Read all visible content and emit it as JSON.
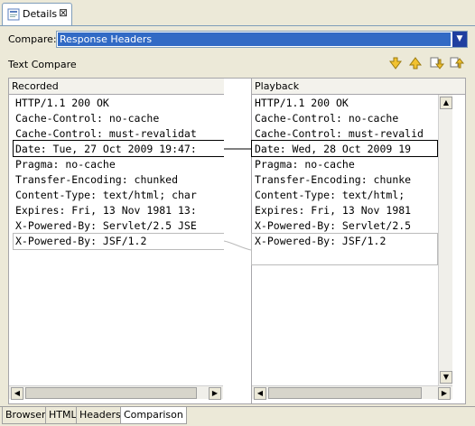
{
  "view_tab": {
    "label": "Details",
    "close": "⊠"
  },
  "compare": {
    "label": "Compare:",
    "value": "Response Headers"
  },
  "text_compare_label": "Text Compare",
  "left": {
    "title": "Recorded",
    "lines": [
      "HTTP/1.1 200 OK",
      "Cache-Control: no-cache",
      "Cache-Control: must-revalidat",
      "Date: Tue, 27 Oct 2009 19:47:",
      "Pragma: no-cache",
      "Transfer-Encoding: chunked",
      "Content-Type: text/html; char",
      "Expires: Fri, 13 Nov 1981 13:",
      "X-Powered-By: Servlet/2.5 JSE",
      "X-Powered-By: JSF/1.2"
    ]
  },
  "right": {
    "title": "Playback",
    "lines": [
      "HTTP/1.1 200 OK",
      "Cache-Control: no-cache",
      "Cache-Control: must-revalid",
      "Date: Wed, 28 Oct 2009 19",
      "Pragma: no-cache",
      "Transfer-Encoding: chunke",
      "Content-Type: text/html;",
      "Expires: Fri, 13 Nov 1981",
      "X-Powered-By: Servlet/2.5",
      "X-Powered-By: JSF/1.2"
    ]
  },
  "bottom_tabs": [
    "Browser",
    "HTML",
    "Headers",
    "Comparison"
  ],
  "active_bottom_tab": "Comparison",
  "colors": {
    "selection": "#316ac5",
    "diff_highlight": "#d8d8d8",
    "border": "#7f9db9"
  }
}
